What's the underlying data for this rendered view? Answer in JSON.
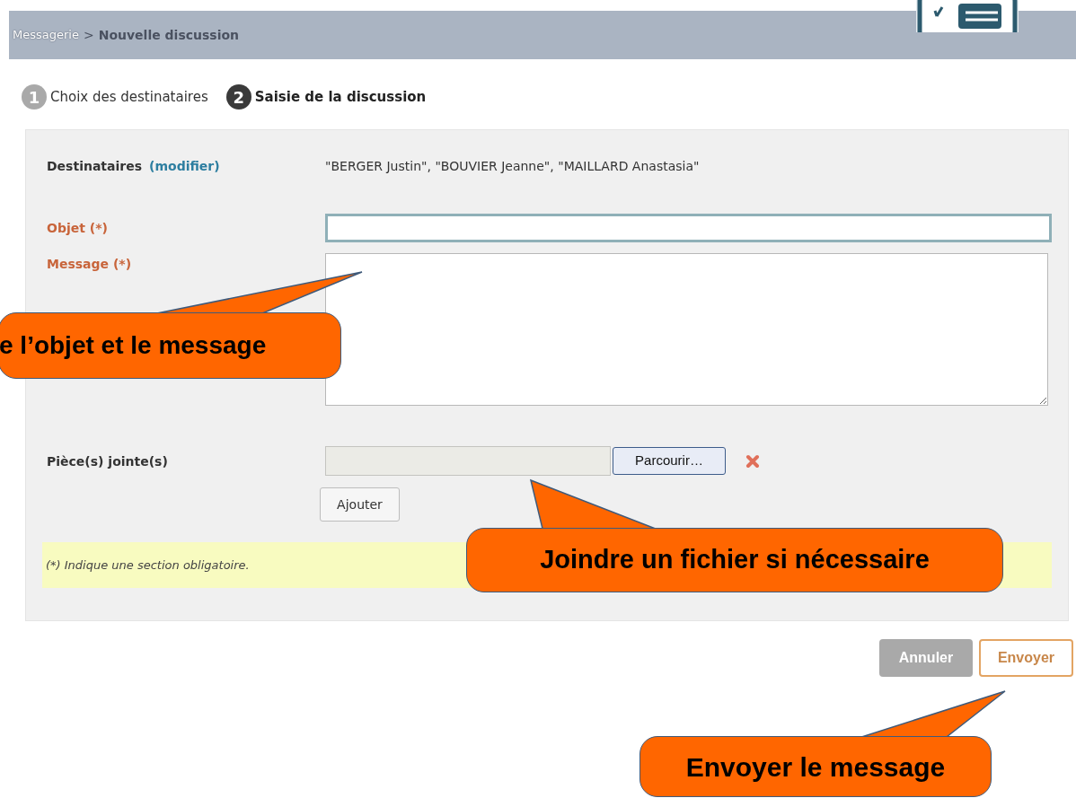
{
  "breadcrumb": {
    "parent": "Messagerie",
    "separator": ">",
    "current": "Nouvelle discussion"
  },
  "steps": [
    {
      "number": "1",
      "label": "Choix des destinataires",
      "selected": false
    },
    {
      "number": "2",
      "label": "Saisie de la discussion",
      "selected": true
    }
  ],
  "form": {
    "recipients": {
      "label": "Destinataires",
      "link": "(modifier)",
      "value": "\"BERGER Justin\", \"BOUVIER Jeanne\", \"MAILLARD Anastasia\""
    },
    "subject": {
      "label": "Objet (*)"
    },
    "message": {
      "label": "Message (*)"
    },
    "attachments": {
      "label": "Pièce(s) jointe(s)",
      "browse_button": "Parcourir…",
      "add_button": "Ajouter"
    },
    "note": "(*) Indique une section obligatoire."
  },
  "actions": [
    {
      "label": "Annuler",
      "kind": "cancel"
    },
    {
      "label": "Envoyer",
      "kind": "submit"
    }
  ],
  "callouts": [
    "e l’objet et le message",
    "Joindre un fichier si nécessaire",
    "Envoyer le message"
  ]
}
